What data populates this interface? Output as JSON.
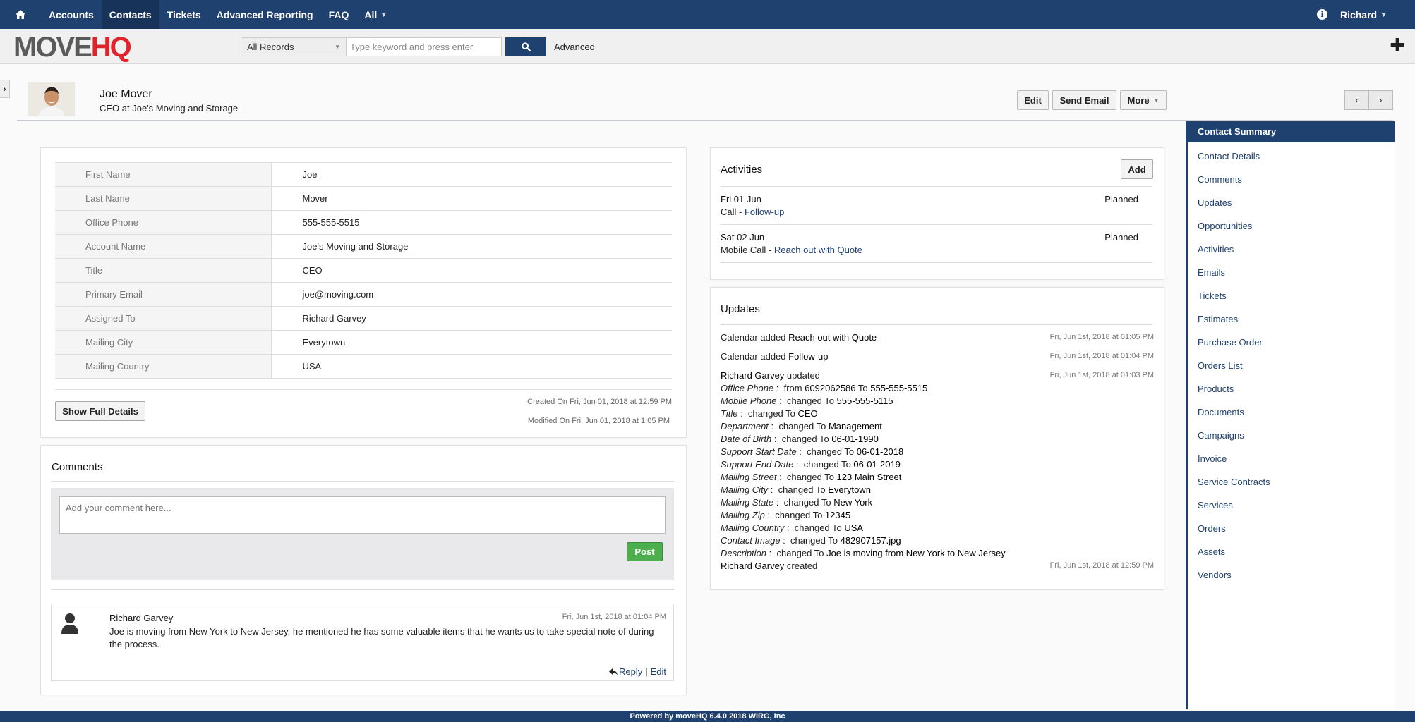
{
  "nav": {
    "items": [
      {
        "label": "Accounts",
        "active": false
      },
      {
        "label": "Contacts",
        "active": true
      },
      {
        "label": "Tickets",
        "active": false
      },
      {
        "label": "Advanced Reporting",
        "active": false
      },
      {
        "label": "FAQ",
        "active": false
      },
      {
        "label": "All",
        "active": false
      }
    ],
    "user": "Richard"
  },
  "header": {
    "logo_move": "MOVE",
    "logo_hq": "HQ",
    "records_select": "All Records",
    "search_placeholder": "Type keyword and press enter",
    "advanced": "Advanced"
  },
  "contact": {
    "name": "Joe Mover",
    "subtitle": "CEO at Joe's Moving and Storage",
    "buttons": {
      "edit": "Edit",
      "send_email": "Send Email",
      "more": "More"
    }
  },
  "details": {
    "rows": [
      {
        "label": "First Name",
        "value": "Joe"
      },
      {
        "label": "Last Name",
        "value": "Mover"
      },
      {
        "label": "Office Phone",
        "value": "555-555-5515"
      },
      {
        "label": "Account Name",
        "value": "Joe's Moving and Storage"
      },
      {
        "label": "Title",
        "value": "CEO"
      },
      {
        "label": "Primary Email",
        "value": "joe@moving.com"
      },
      {
        "label": "Assigned To",
        "value": "Richard Garvey"
      },
      {
        "label": "Mailing City",
        "value": "Everytown"
      },
      {
        "label": "Mailing Country",
        "value": "USA"
      }
    ],
    "show_full_details": "Show Full Details",
    "created": "Created On Fri, Jun 01, 2018 at 12:59 PM",
    "modified": "Modified On Fri, Jun 01, 2018 at 1:05 PM"
  },
  "comments": {
    "title": "Comments",
    "placeholder": "Add your comment here...",
    "post": "Post",
    "items": [
      {
        "author": "Richard Garvey",
        "time": "Fri, Jun 1st, 2018 at 01:04 PM",
        "text": "Joe is moving from New York to New Jersey, he mentioned he has some valuable items that he wants us to take special note of during the process.",
        "reply": "Reply",
        "separator": "|",
        "edit": "Edit"
      }
    ]
  },
  "activities": {
    "title": "Activities",
    "add": "Add",
    "items": [
      {
        "date": "Fri 01 Jun",
        "type": "Call",
        "dash": " - ",
        "subject": "Follow-up",
        "status": "Planned"
      },
      {
        "date": "Sat 02 Jun",
        "type": "Mobile Call",
        "dash": " - ",
        "subject": "Reach out with Quote",
        "status": "Planned"
      }
    ]
  },
  "updates": {
    "title": "Updates",
    "entries": [
      {
        "prefix": "Calendar added ",
        "strong": "Reach out with Quote",
        "time": "Fri, Jun 1st, 2018 at 01:05 PM"
      },
      {
        "prefix": "Calendar added ",
        "strong": "Follow-up",
        "time": "Fri, Jun 1st, 2018 at 01:04 PM"
      },
      {
        "prefix": "",
        "strong": "Richard Garvey",
        "suffix": " updated",
        "time": "Fri, Jun 1st, 2018 at 01:03 PM"
      }
    ],
    "changes": [
      {
        "field": "Office Phone",
        "sep": " :  from ",
        "from": "6092062586",
        "to_label": " To ",
        "to": "555-555-5515"
      },
      {
        "field": "Mobile Phone",
        "sep": " :  changed To ",
        "to": "555-555-5115"
      },
      {
        "field": "Title",
        "sep": " :  changed To ",
        "to": "CEO"
      },
      {
        "field": "Department",
        "sep": " :  changed To ",
        "to": "Management"
      },
      {
        "field": "Date of Birth",
        "sep": " :  changed To ",
        "to": "06-01-1990"
      },
      {
        "field": "Support Start Date",
        "sep": " :  changed To ",
        "to": "06-01-2018"
      },
      {
        "field": "Support End Date",
        "sep": " :  changed To ",
        "to": "06-01-2019"
      },
      {
        "field": "Mailing Street",
        "sep": " :  changed To ",
        "to": "123 Main Street"
      },
      {
        "field": "Mailing City",
        "sep": " :  changed To ",
        "to": "Everytown"
      },
      {
        "field": "Mailing State",
        "sep": " :  changed To ",
        "to": "New York"
      },
      {
        "field": "Mailing Zip",
        "sep": " :  changed To ",
        "to": "12345"
      },
      {
        "field": "Mailing Country",
        "sep": " :  changed To ",
        "to": "USA"
      },
      {
        "field": "Contact Image",
        "sep": " :  changed To ",
        "to": "482907157.jpg"
      },
      {
        "field": "Description",
        "sep": " :  changed To ",
        "to": "Joe is moving from New York to New Jersey"
      }
    ],
    "created": {
      "strong": "Richard Garvey",
      "suffix": " created",
      "time": "Fri, Jun 1st, 2018 at 12:59 PM"
    }
  },
  "sidebar": {
    "items": [
      "Contact Summary",
      "Contact Details",
      "Comments",
      "Updates",
      "Opportunities",
      "Activities",
      "Emails",
      "Tickets",
      "Estimates",
      "Purchase Order",
      "Orders List",
      "Products",
      "Documents",
      "Campaigns",
      "Invoice",
      "Service Contracts",
      "Services",
      "Orders",
      "Assets",
      "Vendors"
    ],
    "active_index": 0
  },
  "footer": "Powered by moveHQ 6.4.0 2018 WIRG, Inc",
  "colors": {
    "primary": "#1f4170",
    "accent_red": "#e2232a",
    "success": "#4cae4c"
  }
}
